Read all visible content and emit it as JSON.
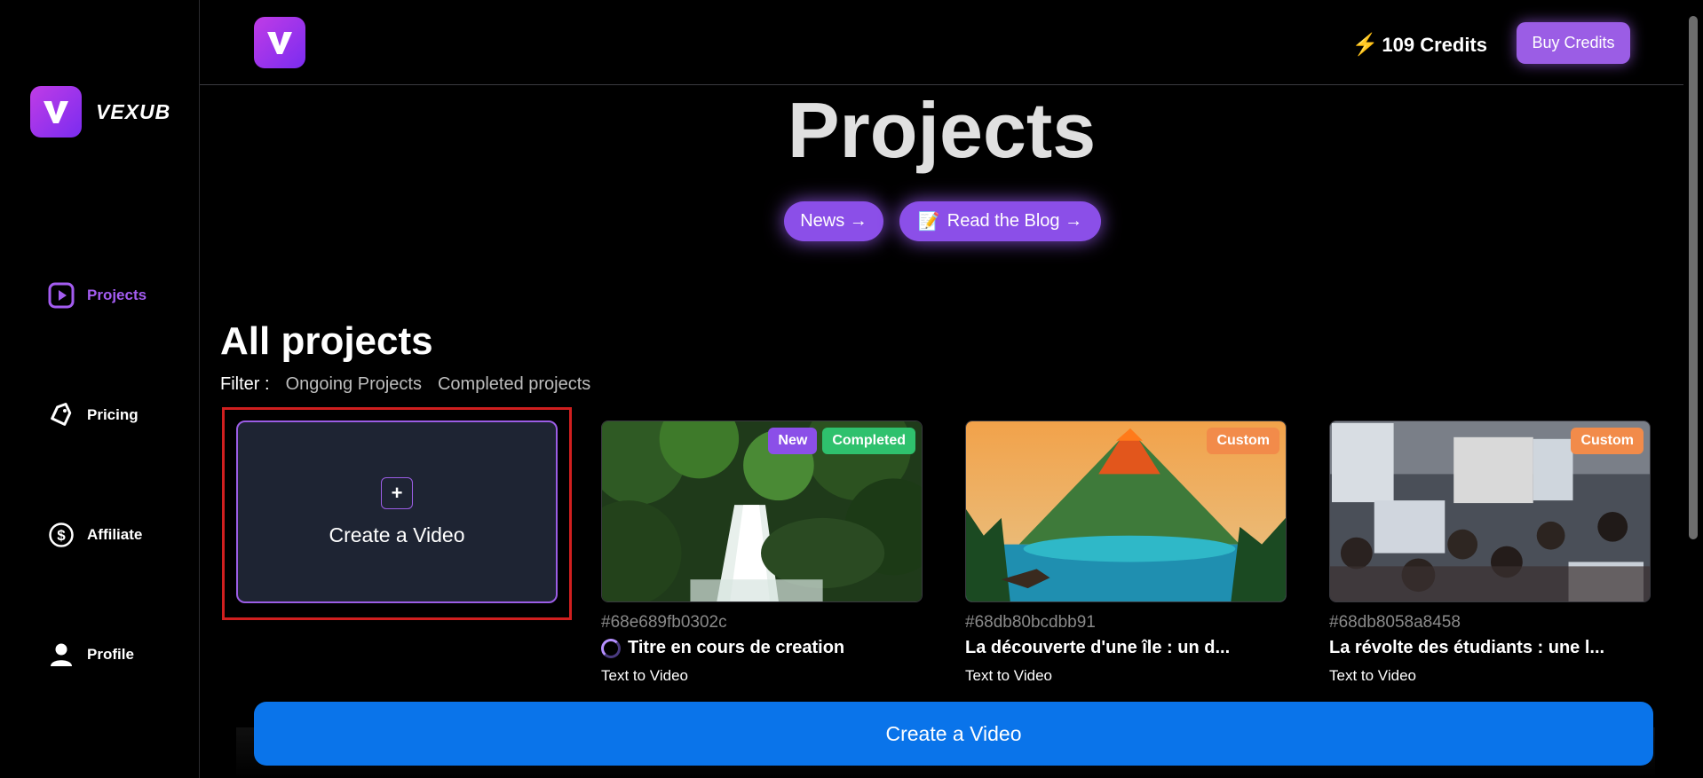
{
  "sidebar": {
    "brand": "VEXUB",
    "items": [
      {
        "label": "Projects",
        "icon": "play-square-icon",
        "active": true
      },
      {
        "label": "Pricing",
        "icon": "tag-icon",
        "active": false
      },
      {
        "label": "Affiliate",
        "icon": "dollar-circle-icon",
        "active": false
      },
      {
        "label": "Profile",
        "icon": "user-icon",
        "active": false
      }
    ]
  },
  "header": {
    "credits": "109 Credits",
    "buy_label": "Buy Credits"
  },
  "main": {
    "title": "Projects",
    "news_label": "News →",
    "blog_label": "Read the Blog →",
    "section_title": "All projects",
    "filter_label": "Filter :",
    "filters": [
      "Ongoing Projects",
      "Completed projects"
    ],
    "create_card_label": "Create a Video",
    "projects": [
      {
        "id": "#68e689fb0302c",
        "title": "Titre en cours de creation",
        "type": "Text to Video",
        "badges": [
          "New",
          "Completed"
        ],
        "in_progress": true,
        "thumb": "waterfall-forest"
      },
      {
        "id": "#68db80bcdbb91",
        "title": "La découverte d'une île : un d...",
        "type": "Text to Video",
        "badges": [
          "Custom"
        ],
        "in_progress": false,
        "thumb": "volcano-island"
      },
      {
        "id": "#68db8058a8458",
        "title": "La révolte des étudiants : une l...",
        "type": "Text to Video",
        "badges": [
          "Custom"
        ],
        "in_progress": false,
        "thumb": "student-protest"
      }
    ],
    "cta_label": "Create a Video"
  },
  "colors": {
    "accent": "#9b5de5",
    "cta": "#0a74ea",
    "badge_completed": "#2fc16d",
    "badge_custom": "#f28b4a",
    "highlight_border": "#d01f1f"
  }
}
